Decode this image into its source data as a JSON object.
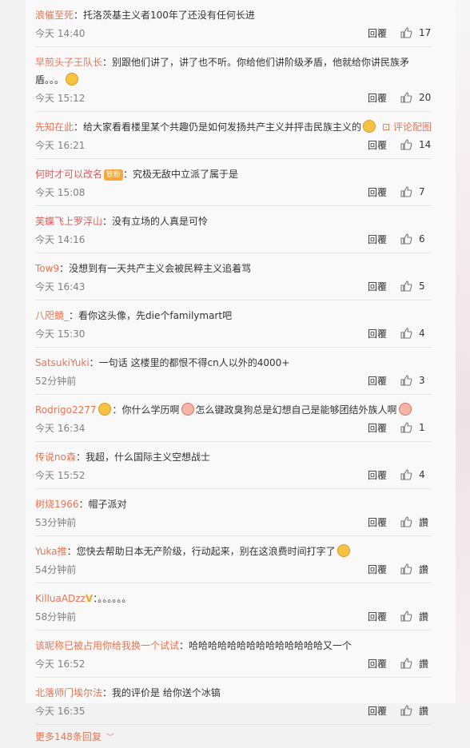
{
  "comments": [
    {
      "user": "浪催至死",
      "text": "：托洛茨基主义者100年了还没有任何长进",
      "time": "今天 14:40",
      "reply": "回覆",
      "likes": "17"
    },
    {
      "user": "早煎头子王队长",
      "text": "：别跟他们讲了，讲了也不听。你给他们讲阶级矛盾，他就给你讲民族矛盾。。。",
      "time": "今天 15:12",
      "reply": "回覆",
      "likes": "20"
    },
    {
      "user": "先知在此",
      "text": "：给大家看看楼里某个共趣仍是如何发扬共产主义并抨击民族主义的",
      "pic": "评论配图",
      "time": "今天 16:21",
      "reply": "回覆",
      "likes": "14"
    },
    {
      "user": "何时才可以改名",
      "badge": "铁粉",
      "text": "：究极无敌中立派了属于是",
      "time": "今天 15:08",
      "reply": "回覆",
      "likes": "7"
    },
    {
      "user": "芙蝶飞上罗浮山",
      "text": "：没有立场的人真是可怜",
      "time": "今天 14:16",
      "reply": "回覆",
      "likes": "6"
    },
    {
      "user": "Tow9",
      "text": "：没想到有一天共产主义会被民粹主义追着骂",
      "time": "今天 16:43",
      "reply": "回覆",
      "likes": "5"
    },
    {
      "user": "八咫鏡_",
      "text": "：看你这头像，先die个familymart吧",
      "time": "今天 15:30",
      "reply": "回覆",
      "likes": "4"
    },
    {
      "user": "SatsukiYuki",
      "text": "：一句话 这楼里的都恨不得cn人以外的4000+",
      "time": "52分钟前",
      "reply": "回覆",
      "likes": "3"
    },
    {
      "user": "Rodrigo2277",
      "text": "：你什么学历啊",
      "text2": "怎么键政臭狗总是幻想自己是能够团结外族人啊",
      "time": "今天 16:34",
      "reply": "回覆",
      "likes": "1"
    },
    {
      "user": "传说no森",
      "text": "：我超，什么国际主义空想战士",
      "time": "今天 15:52",
      "reply": "回覆",
      "likes": "4"
    },
    {
      "user": "树烧1966",
      "text": "：帽子派对",
      "time": "53分钟前",
      "reply": "回覆",
      "likes": "讚"
    },
    {
      "user": "Yuka推",
      "text": "：您快去帮助日本无产阶级，行动起来，别在这浪费时间打字了",
      "time": "54分钟前",
      "reply": "回覆",
      "likes": "讚"
    },
    {
      "user": "KilluaADzz",
      "text": "：。。。。。。",
      "time": "58分钟前",
      "reply": "回覆",
      "likes": "讚"
    },
    {
      "user": "该昵称已被占用你给我换一个试试",
      "text": "：哈哈哈哈哈哈哈哈哈哈哈哈哈哈又一个",
      "time": "今天 16:52",
      "reply": "回覆",
      "likes": "讚"
    },
    {
      "user": "北落师门埃尔法",
      "text": "：我的评价是 给你送个冰镐",
      "time": "今天 16:35",
      "reply": "回覆",
      "likes": "讚"
    }
  ],
  "more": {
    "label": "更多148条回复",
    "chevron": "chevron-down-icon"
  },
  "colors": {
    "username": "#eb7350",
    "accent": "#eb7350",
    "text": "#333333",
    "meta": "#808080"
  }
}
